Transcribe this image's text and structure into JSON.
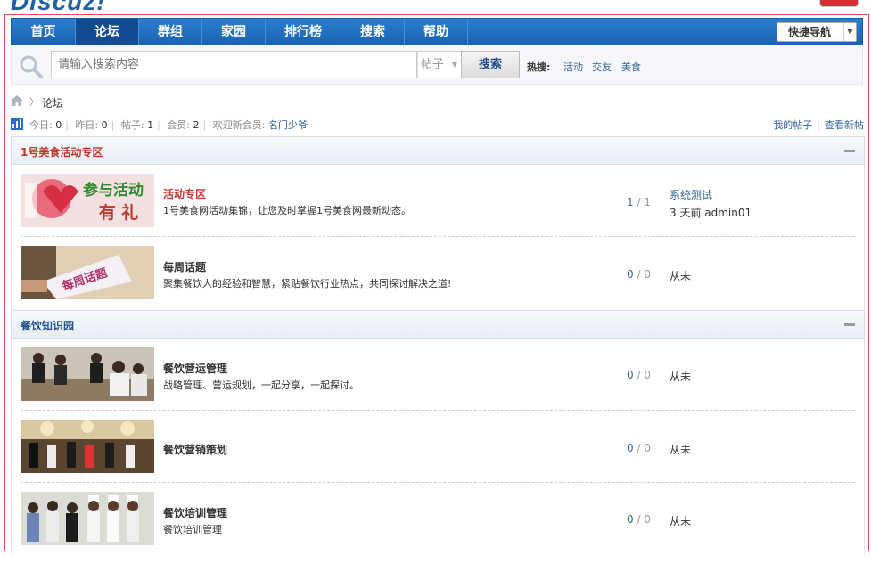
{
  "nav": {
    "items": [
      "首页",
      "论坛",
      "群组",
      "家园",
      "排行榜",
      "搜索",
      "帮助"
    ],
    "quick_nav": "快捷导航"
  },
  "search": {
    "placeholder": "请输入搜索内容",
    "scope": "帖子",
    "button": "搜索",
    "hot_label": "热搜:",
    "hot_links": [
      "活动",
      "交友",
      "美食"
    ]
  },
  "breadcrumb": {
    "current": "论坛"
  },
  "stats": {
    "today_label": "今日:",
    "today": "0",
    "yesterday_label": "昨日:",
    "yesterday": "0",
    "posts_label": "帖子:",
    "posts": "1",
    "members_label": "会员:",
    "members": "2",
    "welcome_label": "欢迎新会员:",
    "new_member": "名门少爷",
    "my_posts": "我的帖子",
    "new_posts": "查看新帖"
  },
  "categories": [
    {
      "title": "1号美食活动专区",
      "color": "#c0392b",
      "forums": [
        {
          "name": "活动专区",
          "desc": "1号美食网活动集锦，让您及时掌握1号美食网最新动态。",
          "threads": "1",
          "posts": "1",
          "last_title": "系统测试",
          "last_meta": "3 天前 admin01",
          "thumb_text": "参与活动有礼"
        },
        {
          "name": "每周话题",
          "desc": "聚集餐饮人的经验和智慧，紧贴餐饮行业热点，共同探讨解决之道!",
          "threads": "0",
          "posts": "0",
          "last_title": "",
          "last_meta": "从未",
          "thumb_text": "每周话题"
        }
      ]
    },
    {
      "title": "餐饮知识园",
      "color": "#1f4f8a",
      "forums": [
        {
          "name": "餐饮营运管理",
          "desc": "战略管理、营运规划，一起分享，一起探讨。",
          "threads": "0",
          "posts": "0",
          "last_title": "",
          "last_meta": "从未"
        },
        {
          "name": "餐饮营销策划",
          "desc": "",
          "threads": "0",
          "posts": "0",
          "last_title": "",
          "last_meta": "从未"
        },
        {
          "name": "餐饮培训管理",
          "desc": "餐饮培训管理",
          "threads": "0",
          "posts": "0",
          "last_title": "",
          "last_meta": "从未"
        }
      ]
    }
  ]
}
